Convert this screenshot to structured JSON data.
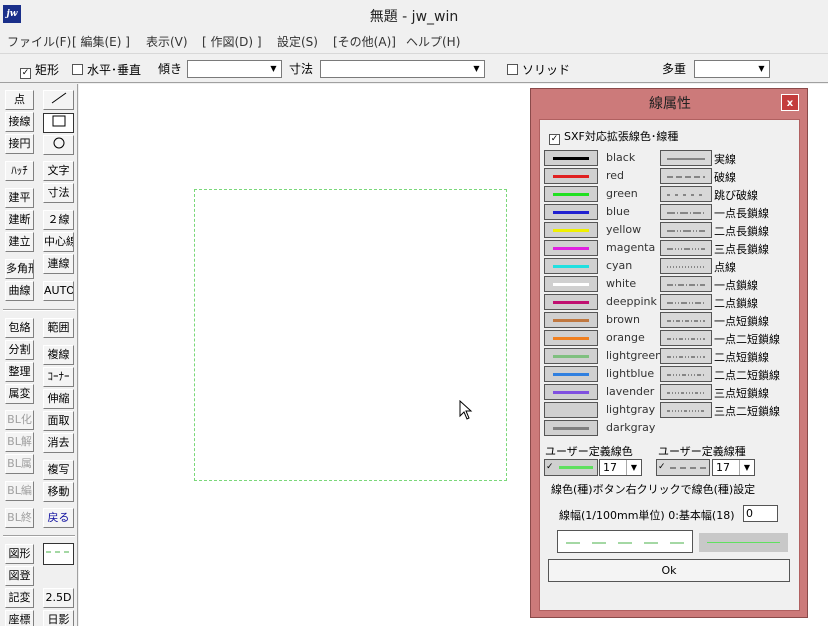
{
  "window": {
    "title": "無題 - jw_win",
    "icon_label": "jw"
  },
  "menu": [
    "ファイル(F)",
    "[ 編集(E) ]",
    "表示(V)",
    "[ 作図(D) ]",
    "設定(S)",
    "[その他(A)]",
    "ヘルプ(H)"
  ],
  "toolbar": {
    "rect_checkbox": {
      "label": "矩形",
      "checked": true
    },
    "hv_checkbox": {
      "label": "水平･垂直",
      "checked": false
    },
    "tilt_label": "傾き",
    "tilt_value": "",
    "dim_label": "寸法",
    "dim_value": "",
    "solid_checkbox": {
      "label": "ソリッド",
      "checked": false
    },
    "multi_label": "多重",
    "multi_value": ""
  },
  "tools": {
    "col1_a": [
      "点",
      "接線",
      "接円",
      "ﾊｯﾁ",
      "建平",
      "建断",
      "建立",
      "多角形",
      "曲線"
    ],
    "col2_a": [
      "文字",
      "寸法",
      "２線",
      "中心線",
      "連線",
      "AUTO"
    ],
    "col1_b": [
      "包絡",
      "分割",
      "整理",
      "属変",
      "BL化",
      "BL解",
      "BL属",
      "BL編",
      "BL終"
    ],
    "col2_b": [
      "範囲",
      "複線",
      "ｺｰﾅｰ",
      "伸縮",
      "面取",
      "消去",
      "複写",
      "移動",
      "戻る"
    ],
    "col1_c": [
      "図形",
      "図登",
      "記変",
      "座標"
    ],
    "col2_c": [
      "2.5D",
      "日影"
    ],
    "line_icon": "line-tool-icon",
    "rect_icon": "rect-tool-icon",
    "circle_icon": "circle-tool-icon"
  },
  "canvas": {
    "rect_color": "#7ad87a",
    "cursor_icon": "arrow-cursor-icon"
  },
  "dialog": {
    "title": "線属性",
    "close_label": "x",
    "sxf_checkbox": {
      "label": "SXF対応拡張線色･線種",
      "checked": true
    },
    "colors": [
      {
        "name": "black",
        "hex": "#000000"
      },
      {
        "name": "red",
        "hex": "#e02020"
      },
      {
        "name": "green",
        "hex": "#20e020"
      },
      {
        "name": "blue",
        "hex": "#2020d0"
      },
      {
        "name": "yellow",
        "hex": "#f0f000"
      },
      {
        "name": "magenta",
        "hex": "#e020e0"
      },
      {
        "name": "cyan",
        "hex": "#20e0e0"
      },
      {
        "name": "white",
        "hex": "#ffffff"
      },
      {
        "name": "deeppink",
        "hex": "#c01070"
      },
      {
        "name": "brown",
        "hex": "#c07840"
      },
      {
        "name": "orange",
        "hex": "#f08020"
      },
      {
        "name": "lightgreen",
        "hex": "#80c080"
      },
      {
        "name": "lightblue",
        "hex": "#3080e0"
      },
      {
        "name": "lavender",
        "hex": "#8050e0"
      },
      {
        "name": "lightgray",
        "hex": ""
      },
      {
        "name": "darkgray",
        "hex": "#808080"
      }
    ],
    "line_types": [
      "実線",
      "破線",
      "跳び破線",
      "一点長鎖線",
      "二点長鎖線",
      "三点長鎖線",
      "点線",
      "一点鎖線",
      "二点鎖線",
      "一点短鎖線",
      "一点二短鎖線",
      "二点短鎖線",
      "二点二短鎖線",
      "三点短鎖線",
      "三点二短鎖線"
    ],
    "user_color_label": "ユーザー定義線色",
    "user_type_label": "ユーザー定義線種",
    "user_color_value": "17",
    "user_type_value": "17",
    "user_color_hex": "#60e060",
    "hint": "線色(種)ボタン右クリックで線色(種)設定",
    "width_label": "線幅(1/100mm単位) 0:基本幅(18)",
    "width_value": "0",
    "preview_color": "#60e060",
    "ok_label": "Ok"
  }
}
